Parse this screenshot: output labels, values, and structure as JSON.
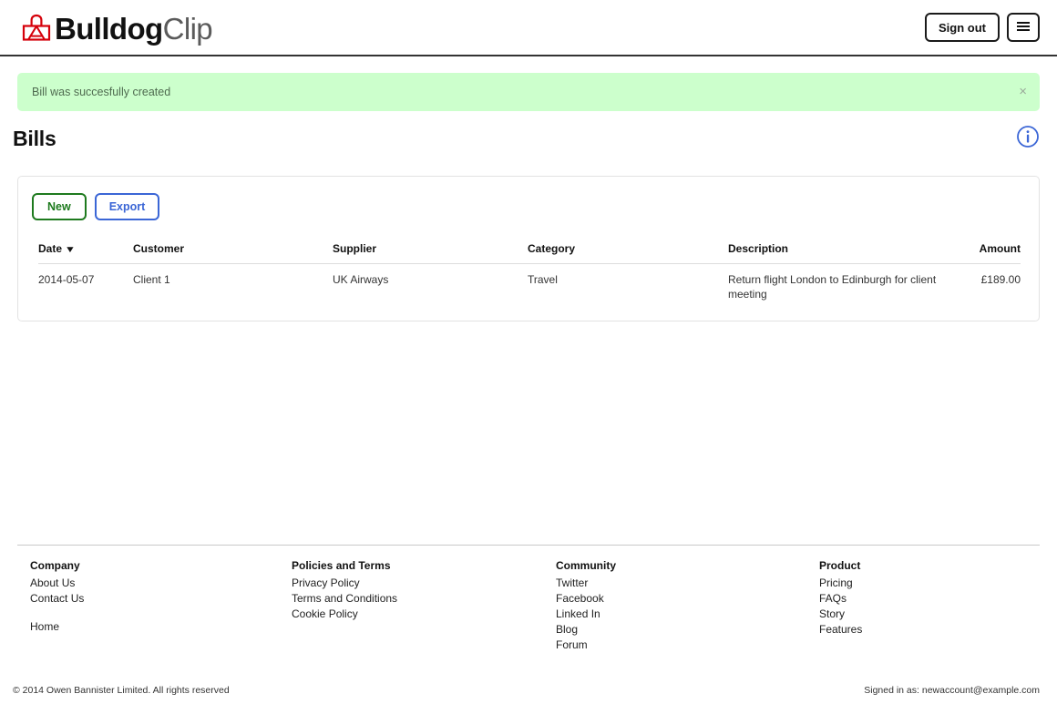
{
  "brand": {
    "name_bold": "Bulldog",
    "name_light": "Clip",
    "logo_icon": "binder-clip-icon",
    "logo_color": "#d5000a"
  },
  "header": {
    "sign_out_label": "Sign out",
    "menu_icon": "hamburger-menu-icon"
  },
  "alert": {
    "message": "Bill was succesfully created",
    "close_label": "×",
    "background_color": "#ccffcc",
    "text_color": "#4f6b50"
  },
  "page": {
    "title": "Bills",
    "info_icon": "info-circle-icon",
    "info_icon_color": "#3b66d6"
  },
  "toolbar": {
    "new_label": "New",
    "new_color": "#1e7a1e",
    "export_label": "Export",
    "export_color": "#3b66d6"
  },
  "table": {
    "sort_column": "Date",
    "sort_caret": "▼",
    "columns": [
      "Date",
      "Customer",
      "Supplier",
      "Category",
      "Description",
      "Amount"
    ],
    "rows": [
      {
        "date": "2014-05-07",
        "customer": "Client 1",
        "supplier": "UK Airways",
        "category": "Travel",
        "description": "Return flight London to Edinburgh for client meeting",
        "amount": "£189.00"
      }
    ]
  },
  "footer": {
    "columns": [
      {
        "heading": "Company",
        "links": [
          "About Us",
          "Contact Us"
        ],
        "extra_links": [
          "Home"
        ]
      },
      {
        "heading": "Policies and Terms",
        "links": [
          "Privacy Policy",
          "Terms and Conditions",
          "Cookie Policy"
        ],
        "extra_links": []
      },
      {
        "heading": "Community",
        "links": [
          "Twitter",
          "Facebook",
          "Linked In",
          "Blog",
          "Forum"
        ],
        "extra_links": []
      },
      {
        "heading": "Product",
        "links": [
          "Pricing",
          "FAQs",
          "Story",
          "Features"
        ],
        "extra_links": []
      }
    ],
    "copyright": "© 2014 Owen Bannister Limited. All rights reserved",
    "signed_in": "Signed in as: newaccount@example.com"
  }
}
